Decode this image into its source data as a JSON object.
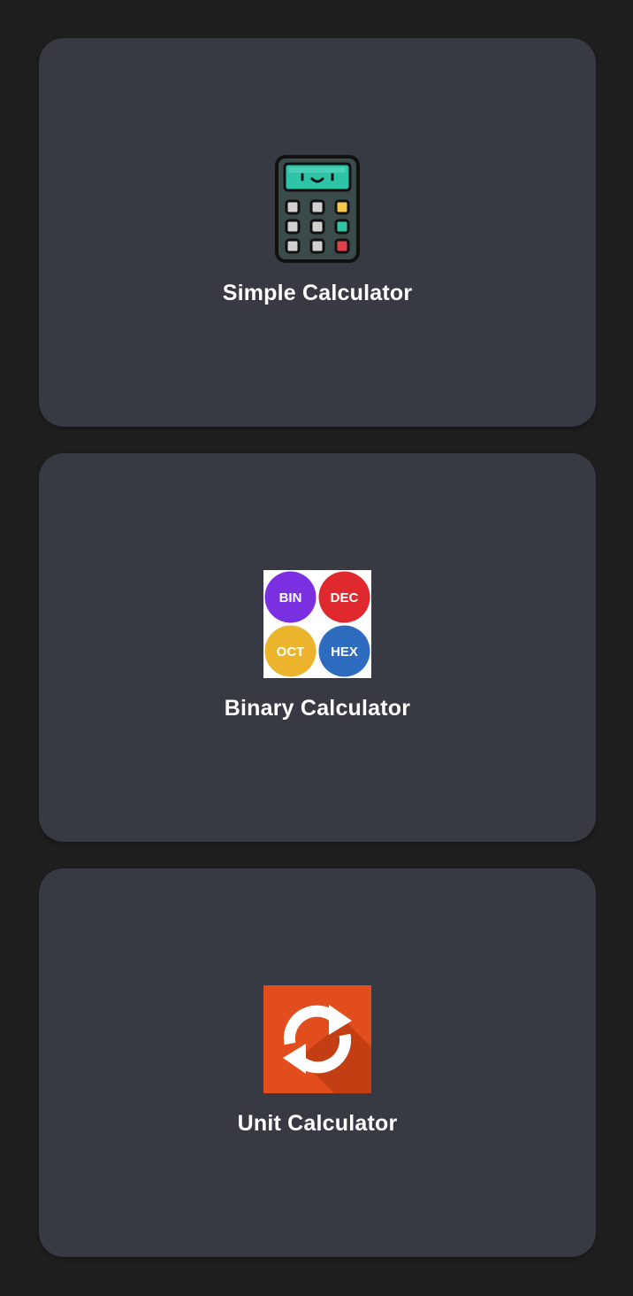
{
  "cards": [
    {
      "label": "Simple Calculator",
      "icon": "calculator-icon"
    },
    {
      "label": "Binary Calculator",
      "icon": "number-bases-icon",
      "badges": [
        "BIN",
        "DEC",
        "OCT",
        "HEX"
      ],
      "badge_colors": [
        "#7a2fe0",
        "#e0292f",
        "#ecb42c",
        "#2e6cc0"
      ]
    },
    {
      "label": "Unit Calculator",
      "icon": "convert-arrows-icon",
      "color": "#e14d1c"
    }
  ],
  "colors": {
    "background": "#1f1f1f",
    "card": "#373a43",
    "text": "#ffffff"
  }
}
